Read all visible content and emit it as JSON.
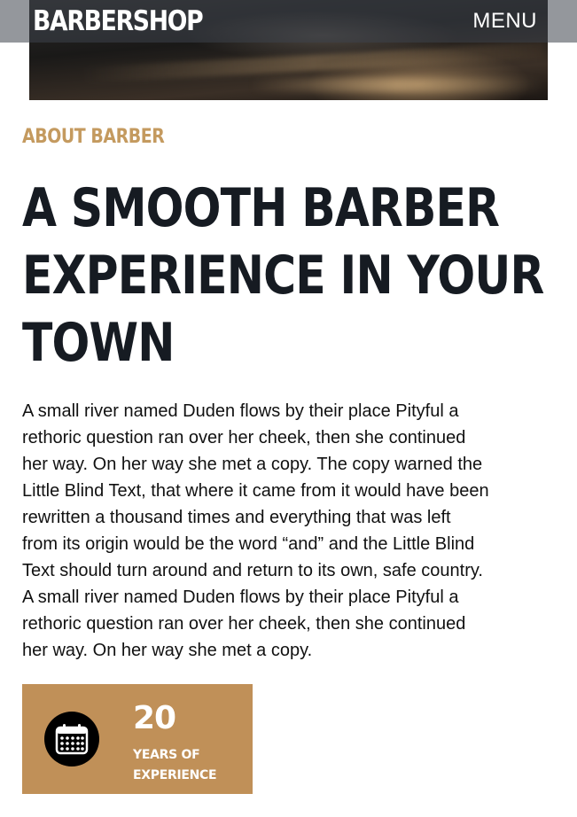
{
  "header": {
    "brand": "BARBERSHOP",
    "menu_label": "MENU"
  },
  "about": {
    "subheading": "ABOUT BARBER",
    "heading_lines": [
      "A SMOOTH BARBER",
      "EXPERIENCE IN YOUR",
      "TOWN"
    ],
    "paragraph_lines": [
      "A small river named Duden flows by their place Pityful a",
      "rethoric question ran over her cheek, then she continued",
      "her way. On her way she met a copy. The copy warned the",
      "Little Blind Text, that where it came from it would have been",
      "rewritten a thousand times and everything that was left",
      "from its origin would be the word “and” and the Little Blind",
      "Text should turn around and return to its own, safe country.",
      "A small river named Duden flows by their place Pityful a",
      "rethoric question ran over her cheek, then she continued",
      "her way. On her way she met a copy."
    ]
  },
  "stat": {
    "icon": "calendar-icon",
    "number": "20",
    "label_lines": [
      "YEARS OF",
      "EXPERIENCE"
    ]
  },
  "colors": {
    "accent": "#c49a5f",
    "heading": "#161b22",
    "card": "#c09058"
  }
}
